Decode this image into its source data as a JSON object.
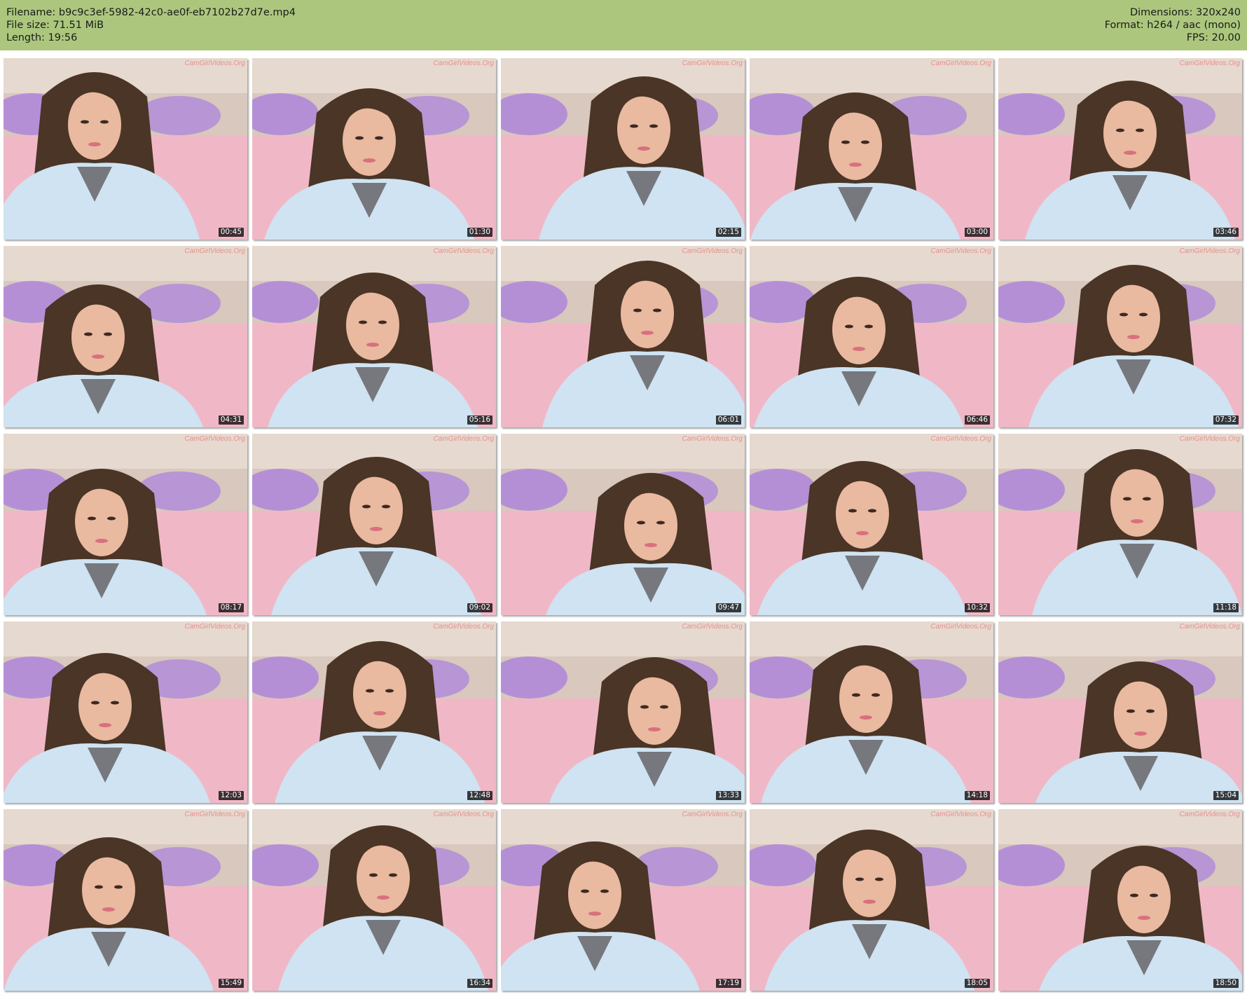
{
  "header": {
    "filename": "Filename: b9c9c3ef-5982-42c0-ae0f-eb7102b27d7e.mp4",
    "filesize": "File size: 71.51 MiB",
    "length": "Length: 19:56",
    "dimensions": "Dimensions: 320x240",
    "format": "Format: h264 / aac (mono)",
    "fps": "FPS: 20.00"
  },
  "watermark": "CamGirlVideos.Org",
  "thumbnails": [
    {
      "time": "00:45"
    },
    {
      "time": "01:30"
    },
    {
      "time": "02:15"
    },
    {
      "time": "03:00"
    },
    {
      "time": "03:46"
    },
    {
      "time": "04:31"
    },
    {
      "time": "05:16"
    },
    {
      "time": "06:01"
    },
    {
      "time": "06:46"
    },
    {
      "time": "07:32"
    },
    {
      "time": "08:17"
    },
    {
      "time": "09:02"
    },
    {
      "time": "09:47"
    },
    {
      "time": "10:32"
    },
    {
      "time": "11:18"
    },
    {
      "time": "12:03"
    },
    {
      "time": "12:48"
    },
    {
      "time": "13:33"
    },
    {
      "time": "14:18"
    },
    {
      "time": "15:04"
    },
    {
      "time": "15:49"
    },
    {
      "time": "16:34"
    },
    {
      "time": "17:19"
    },
    {
      "time": "18:05"
    },
    {
      "time": "18:50"
    }
  ],
  "colors": {
    "header_bg": "#acc77d",
    "wall": "#e6d9cf",
    "pillow": "#b58fd6",
    "bedsheet": "#f0b8c6",
    "robe": "#cfe3f2",
    "hair": "#4a3526",
    "skin": "#e9b9a0"
  }
}
